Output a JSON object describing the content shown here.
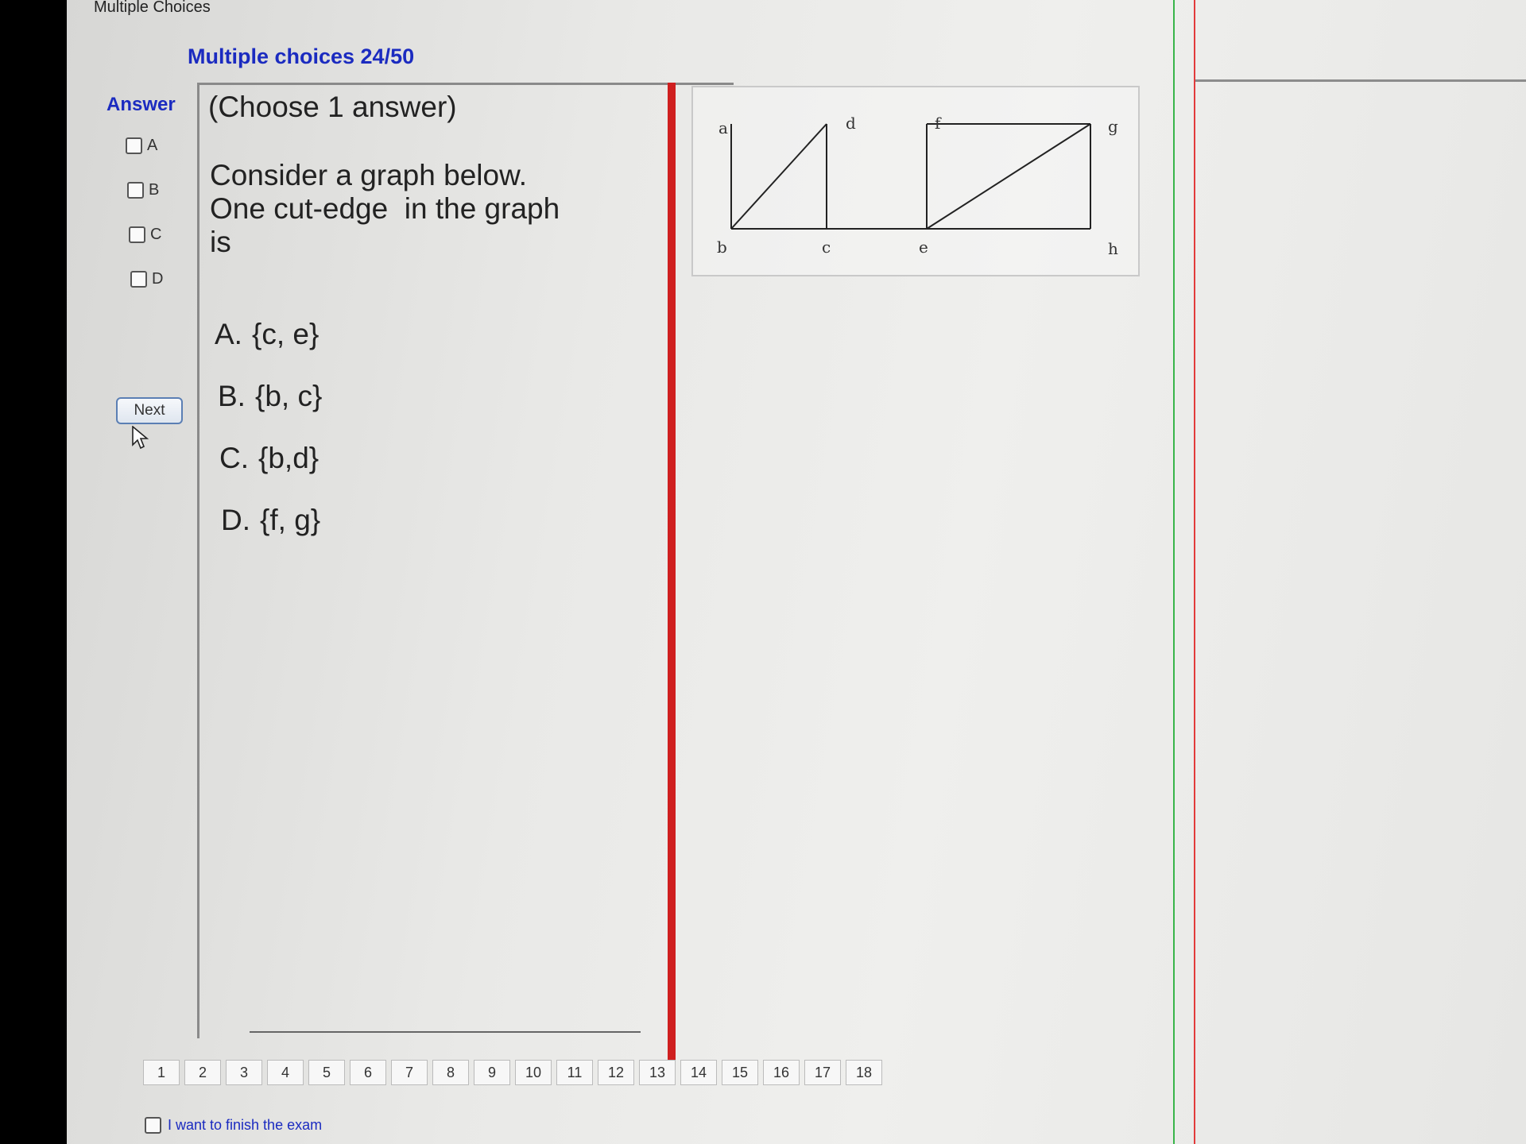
{
  "window": {
    "title": "Multiple Choices"
  },
  "header": {
    "title": "Multiple choices 24/50"
  },
  "answer": {
    "label": "Answer",
    "options": [
      "A",
      "B",
      "C",
      "D"
    ],
    "next_label": "Next"
  },
  "question": {
    "instruction": "(Choose 1 answer)",
    "lines": [
      "Consider a graph below.",
      "One cut-edge  in the graph",
      "is"
    ],
    "choices": [
      {
        "letter": "A.",
        "text": "{c, e}"
      },
      {
        "letter": "B.",
        "text": "{b, c}"
      },
      {
        "letter": "C.",
        "text": "{b,d}"
      },
      {
        "letter": "D.",
        "text": "{f, g}"
      }
    ]
  },
  "graph": {
    "vertices": [
      "a",
      "b",
      "c",
      "d",
      "e",
      "f",
      "g",
      "h"
    ],
    "edges": [
      [
        "a",
        "b"
      ],
      [
        "b",
        "d"
      ],
      [
        "b",
        "c"
      ],
      [
        "c",
        "d"
      ],
      [
        "c",
        "e"
      ],
      [
        "e",
        "f"
      ],
      [
        "e",
        "g"
      ],
      [
        "e",
        "h"
      ],
      [
        "f",
        "g"
      ],
      [
        "g",
        "h"
      ]
    ]
  },
  "pagination": {
    "pages": [
      "1",
      "2",
      "3",
      "4",
      "5",
      "6",
      "7",
      "8",
      "9",
      "10",
      "11",
      "12",
      "13",
      "14",
      "15",
      "16",
      "17",
      "18"
    ]
  },
  "finish": {
    "label": "I want to finish the exam"
  }
}
